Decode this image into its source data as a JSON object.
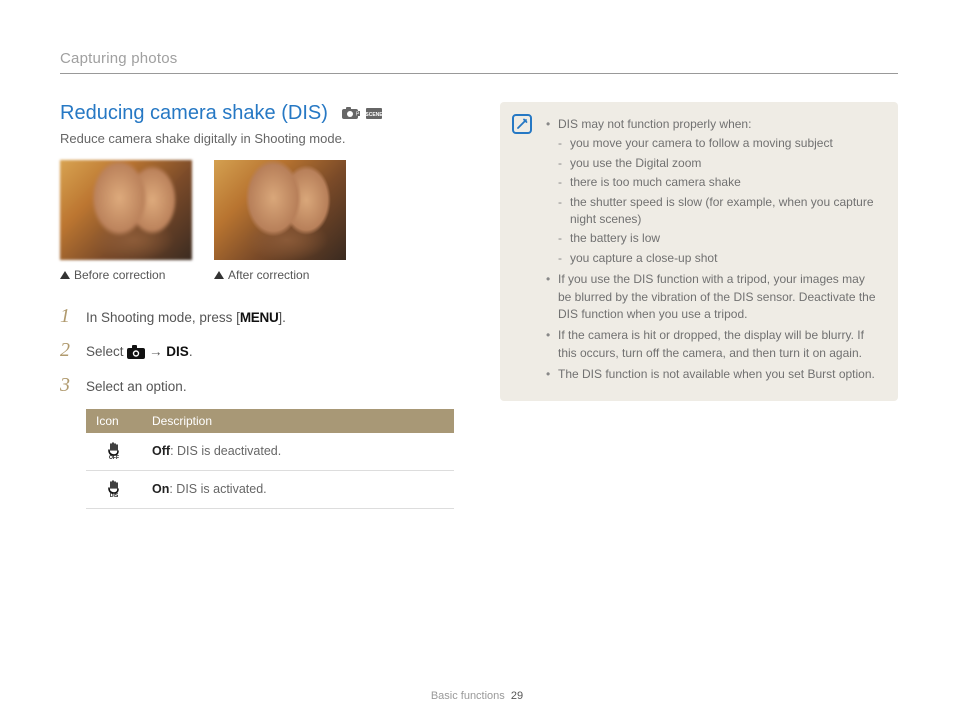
{
  "breadcrumb": "Capturing photos",
  "section": {
    "title": "Reducing camera shake (DIS)",
    "subtitle": "Reduce camera shake digitally in Shooting mode."
  },
  "photos": {
    "before": "Before correction",
    "after": "After correction"
  },
  "steps": {
    "s1_a": "In Shooting mode, press [",
    "s1_menu": "MENU",
    "s1_b": "].",
    "s2_a": "Select ",
    "s2_arrow": " → ",
    "s2_dis": "DIS",
    "s2_b": ".",
    "s3": "Select an option."
  },
  "table": {
    "h_icon": "Icon",
    "h_desc": "Description",
    "off_b": "Off",
    "off_t": ": DIS is deactivated.",
    "on_b": "On",
    "on_t": ": DIS is activated."
  },
  "note": {
    "l1": "DIS may not function properly when:",
    "l1a": "you move your camera to follow a moving subject",
    "l1b": "you use the Digital zoom",
    "l1c": "there is too much camera shake",
    "l1d": "the shutter speed is slow (for example, when you capture night scenes)",
    "l1e": "the battery is low",
    "l1f": "you capture a close-up shot",
    "l2": "If you use the DIS function with a tripod, your images may be blurred by the vibration of the DIS sensor. Deactivate the DIS function when you use a tripod.",
    "l3": "If the camera is hit or dropped, the display will be blurry. If this occurs, turn off the camera, and then turn it on again.",
    "l4": "The DIS function is not available when you set Burst option."
  },
  "footer": {
    "section": "Basic functions",
    "page": "29"
  }
}
